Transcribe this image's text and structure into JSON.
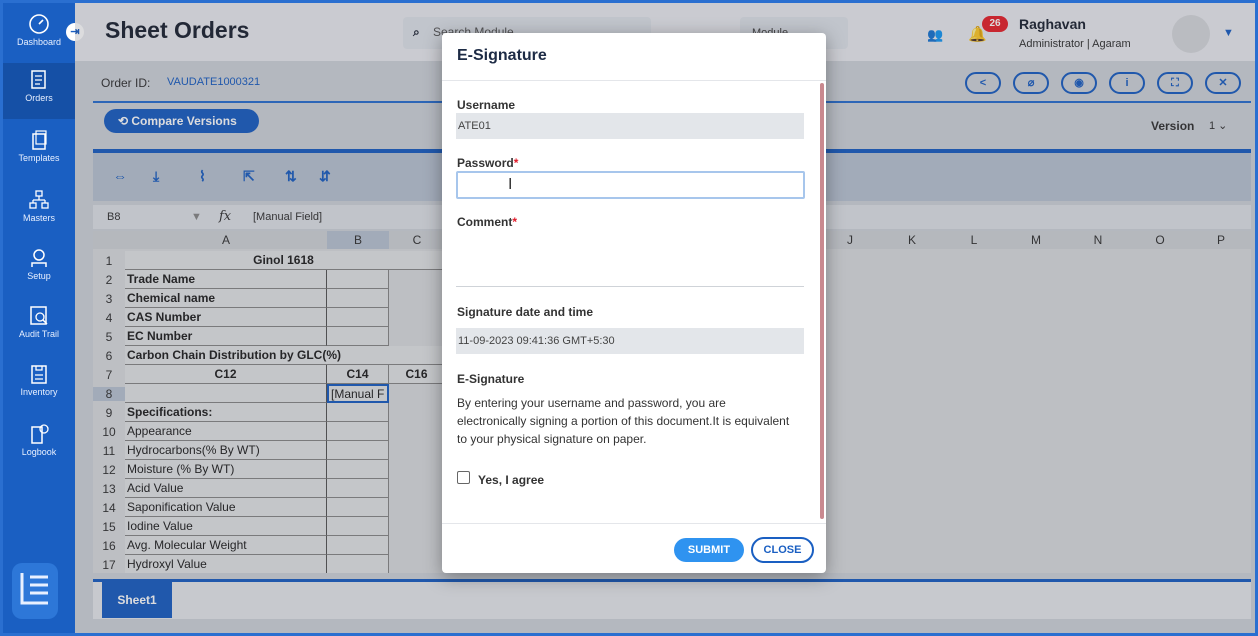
{
  "sidebar": {
    "items": [
      {
        "label": "Dashboard",
        "icon": "dashboard-icon"
      },
      {
        "label": "Orders",
        "icon": "orders-icon"
      },
      {
        "label": "Templates",
        "icon": "templates-icon"
      },
      {
        "label": "Masters",
        "icon": "masters-icon"
      },
      {
        "label": "Setup",
        "icon": "setup-icon"
      },
      {
        "label": "Audit Trail",
        "icon": "audit-icon"
      },
      {
        "label": "Inventory",
        "icon": "inventory-icon"
      },
      {
        "label": "Logbook",
        "icon": "logbook-icon"
      }
    ]
  },
  "header": {
    "title": "Sheet Orders",
    "search_placeholder": "Search Module",
    "module_select": "Module",
    "notification_count": "26",
    "user_name": "Raghavan",
    "user_role": "Administrator | Agaram"
  },
  "order": {
    "id_label": "Order ID:",
    "id_value": "VAUDATE1000321",
    "compare_label": "Compare Versions",
    "version_label": "Version",
    "version_value": "1"
  },
  "formula_bar": {
    "cell": "B8",
    "fx": "fx",
    "value": "[Manual Field]"
  },
  "grid": {
    "columns": [
      "A",
      "B",
      "C",
      "J",
      "K",
      "L",
      "M",
      "N",
      "O",
      "P"
    ],
    "rows": [
      {
        "n": "1",
        "a": "Ginol 1618",
        "b": ""
      },
      {
        "n": "2",
        "a": "Trade Name",
        "b": ""
      },
      {
        "n": "3",
        "a": "Chemical name",
        "b": ""
      },
      {
        "n": "4",
        "a": "CAS Number",
        "b": ""
      },
      {
        "n": "5",
        "a": "EC Number",
        "b": ""
      },
      {
        "n": "6",
        "a": "Carbon Chain Distribution by GLC(%)",
        "b": ""
      },
      {
        "n": "7",
        "a": "C12",
        "b": "C14",
        "c": "C16"
      },
      {
        "n": "8",
        "a": "",
        "b": "[Manual F"
      },
      {
        "n": "9",
        "a": "Specifications:",
        "b": ""
      },
      {
        "n": "10",
        "a": "Appearance",
        "b": ""
      },
      {
        "n": "11",
        "a": "Hydrocarbons(% By WT)",
        "b": ""
      },
      {
        "n": "12",
        "a": "Moisture (% By WT)",
        "b": ""
      },
      {
        "n": "13",
        "a": "Acid Value",
        "b": ""
      },
      {
        "n": "14",
        "a": "Saponification Value",
        "b": ""
      },
      {
        "n": "15",
        "a": "Iodine Value",
        "b": ""
      },
      {
        "n": "16",
        "a": "Avg. Molecular Weight",
        "b": ""
      },
      {
        "n": "17",
        "a": "Hydroxyl Value",
        "b": ""
      }
    ]
  },
  "sheet_tab": "Sheet1",
  "modal": {
    "title": "E-Signature",
    "username_label": "Username",
    "username_value": "ATE01",
    "password_label": "Password",
    "comment_label": "Comment",
    "required_mark": "*",
    "date_label": "Signature date and time",
    "date_value": "11-09-2023 09:41:36 GMT+5:30",
    "esig_heading": "E-Signature",
    "esig_text": "By entering your username and password, you are electronically signing a portion of this document.It is equivalent to your physical signature on paper.",
    "agree_label": "Yes, I agree",
    "submit_label": "SUBMIT",
    "close_label": "CLOSE"
  },
  "colors": {
    "primary": "#1a5fc2",
    "accent": "#2f93f0",
    "badge": "#e7232b"
  }
}
